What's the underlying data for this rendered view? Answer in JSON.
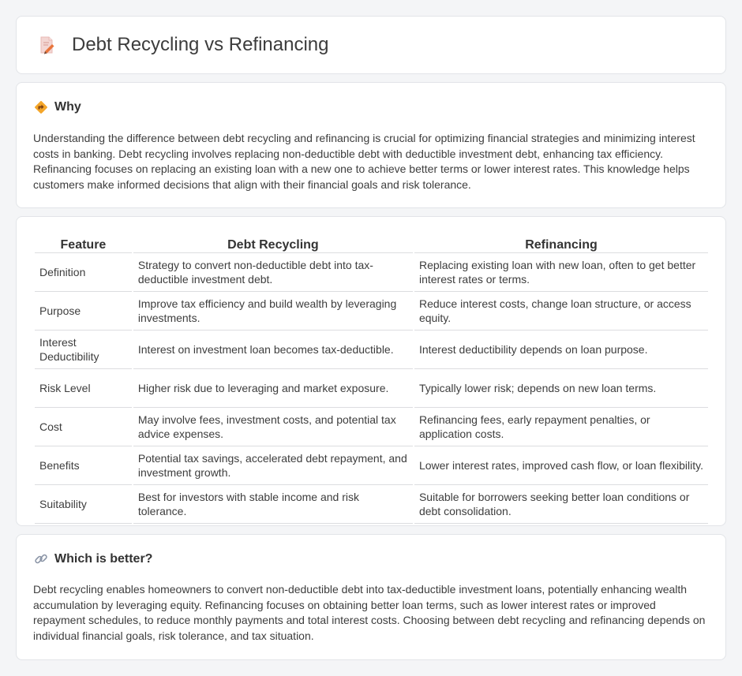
{
  "header": {
    "title": "Debt Recycling vs Refinancing",
    "icon": "document-pencil-icon"
  },
  "why": {
    "title": "Why",
    "icon": "diamond-directions-icon",
    "text": "Understanding the difference between debt recycling and refinancing is crucial for optimizing financial strategies and minimizing interest costs in banking. Debt recycling involves replacing non-deductible debt with deductible investment debt, enhancing tax efficiency. Refinancing focuses on replacing an existing loan with a new one to achieve better terms or lower interest rates. This knowledge helps customers make informed decisions that align with their financial goals and risk tolerance."
  },
  "table": {
    "headers": [
      "Feature",
      "Debt Recycling",
      "Refinancing"
    ],
    "rows": [
      [
        "Definition",
        "Strategy to convert non-deductible debt into tax-deductible investment debt.",
        "Replacing existing loan with new loan, often to get better interest rates or terms."
      ],
      [
        "Purpose",
        "Improve tax efficiency and build wealth by leveraging investments.",
        "Reduce interest costs, change loan structure, or access equity."
      ],
      [
        "Interest Deductibility",
        "Interest on investment loan becomes tax-deductible.",
        "Interest deductibility depends on loan purpose."
      ],
      [
        "Risk Level",
        "Higher risk due to leveraging and market exposure.",
        "Typically lower risk; depends on new loan terms."
      ],
      [
        "Cost",
        "May involve fees, investment costs, and potential tax advice expenses.",
        "Refinancing fees, early repayment penalties, or application costs."
      ],
      [
        "Benefits",
        "Potential tax savings, accelerated debt repayment, and investment growth.",
        "Lower interest rates, improved cash flow, or loan flexibility."
      ],
      [
        "Suitability",
        "Best for investors with stable income and risk tolerance.",
        "Suitable for borrowers seeking better loan conditions or debt consolidation."
      ]
    ]
  },
  "better": {
    "title": "Which is better?",
    "icon": "link-icon",
    "text": "Debt recycling enables homeowners to convert non-deductible debt into tax-deductible investment loans, potentially enhancing wealth accumulation by leveraging equity. Refinancing focuses on obtaining better loan terms, such as lower interest rates or improved repayment schedules, to reduce monthly payments and total interest costs. Choosing between debt recycling and refinancing depends on individual financial goals, risk tolerance, and tax situation."
  }
}
